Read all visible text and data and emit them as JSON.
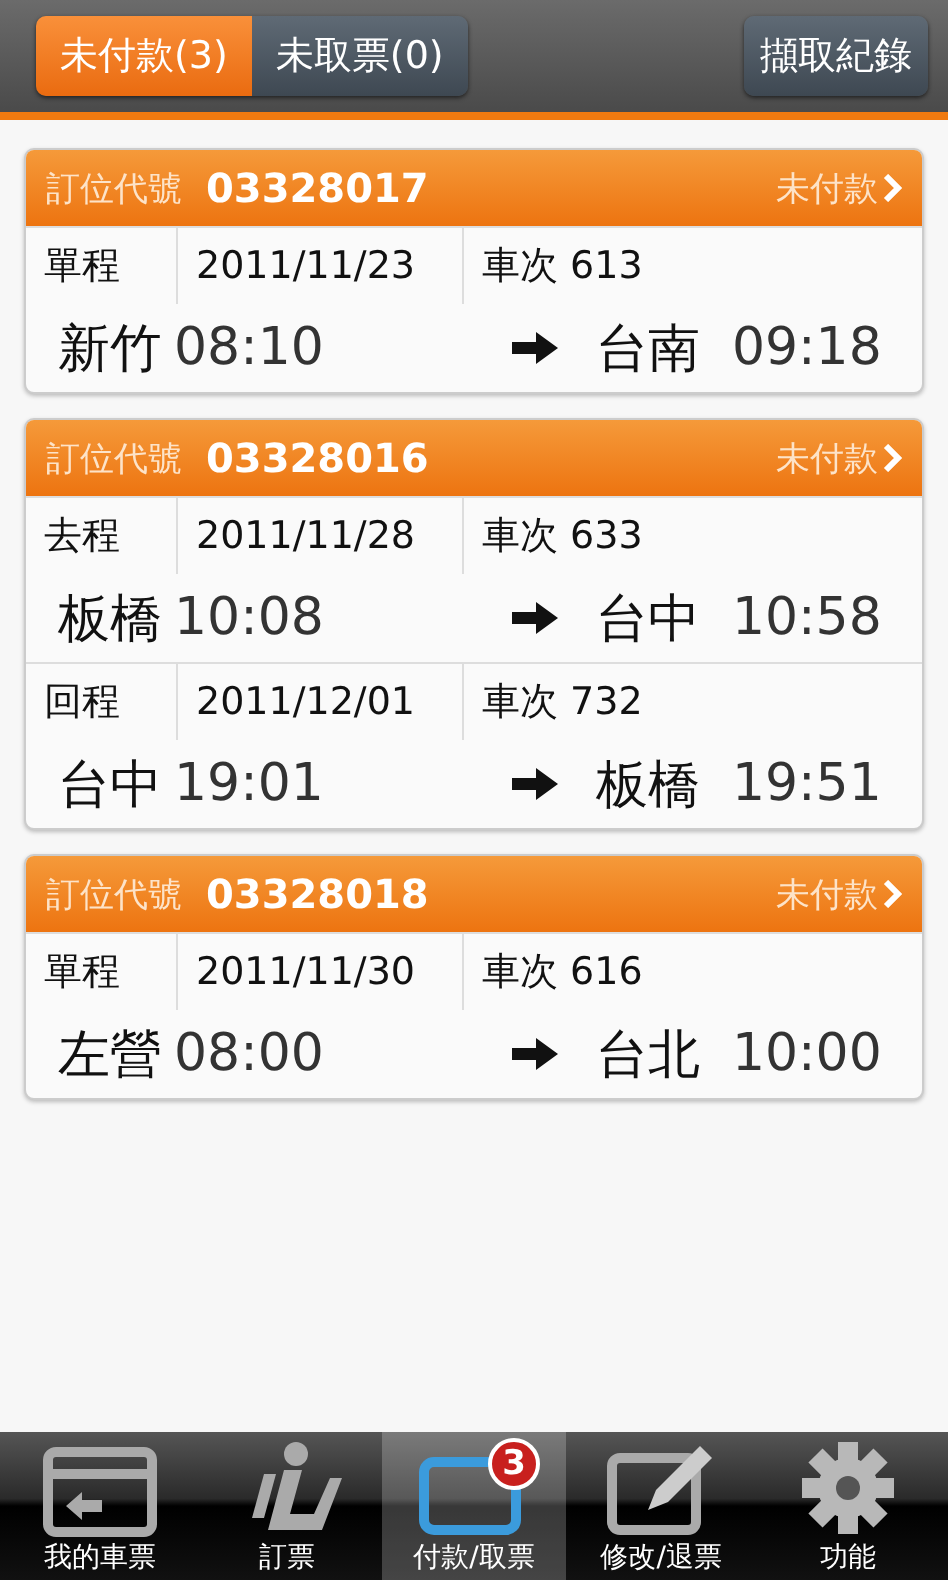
{
  "top_bar": {
    "tabs": [
      {
        "label": "未付款(3)",
        "selected": true
      },
      {
        "label": "未取票(0)",
        "selected": false
      }
    ],
    "action_button": "擷取紀錄"
  },
  "bookings": [
    {
      "code_label": "訂位代號",
      "code": "03328017",
      "status": "未付款",
      "legs": [
        {
          "trip_type": "單程",
          "date": "2011/11/23",
          "train": "車次 613",
          "from": "新竹",
          "depart": "08:10",
          "to": "台南",
          "arrive": "09:18"
        }
      ]
    },
    {
      "code_label": "訂位代號",
      "code": "03328016",
      "status": "未付款",
      "legs": [
        {
          "trip_type": "去程",
          "date": "2011/11/28",
          "train": "車次 633",
          "from": "板橋",
          "depart": "10:08",
          "to": "台中",
          "arrive": "10:58"
        },
        {
          "trip_type": "回程",
          "date": "2011/12/01",
          "train": "車次 732",
          "from": "台中",
          "depart": "19:01",
          "to": "板橋",
          "arrive": "19:51"
        }
      ]
    },
    {
      "code_label": "訂位代號",
      "code": "03328018",
      "status": "未付款",
      "legs": [
        {
          "trip_type": "單程",
          "date": "2011/11/30",
          "train": "車次 616",
          "from": "左營",
          "depart": "08:00",
          "to": "台北",
          "arrive": "10:00"
        }
      ]
    }
  ],
  "bottom_nav": [
    {
      "kind": "ticket",
      "label": "我的車票",
      "selected": false
    },
    {
      "kind": "seat",
      "label": "訂票",
      "selected": false
    },
    {
      "kind": "pay",
      "label": "付款/取票",
      "selected": true,
      "badge": "3"
    },
    {
      "kind": "edit",
      "label": "修改/退票",
      "selected": false
    },
    {
      "kind": "gear",
      "label": "功能",
      "selected": false
    }
  ]
}
